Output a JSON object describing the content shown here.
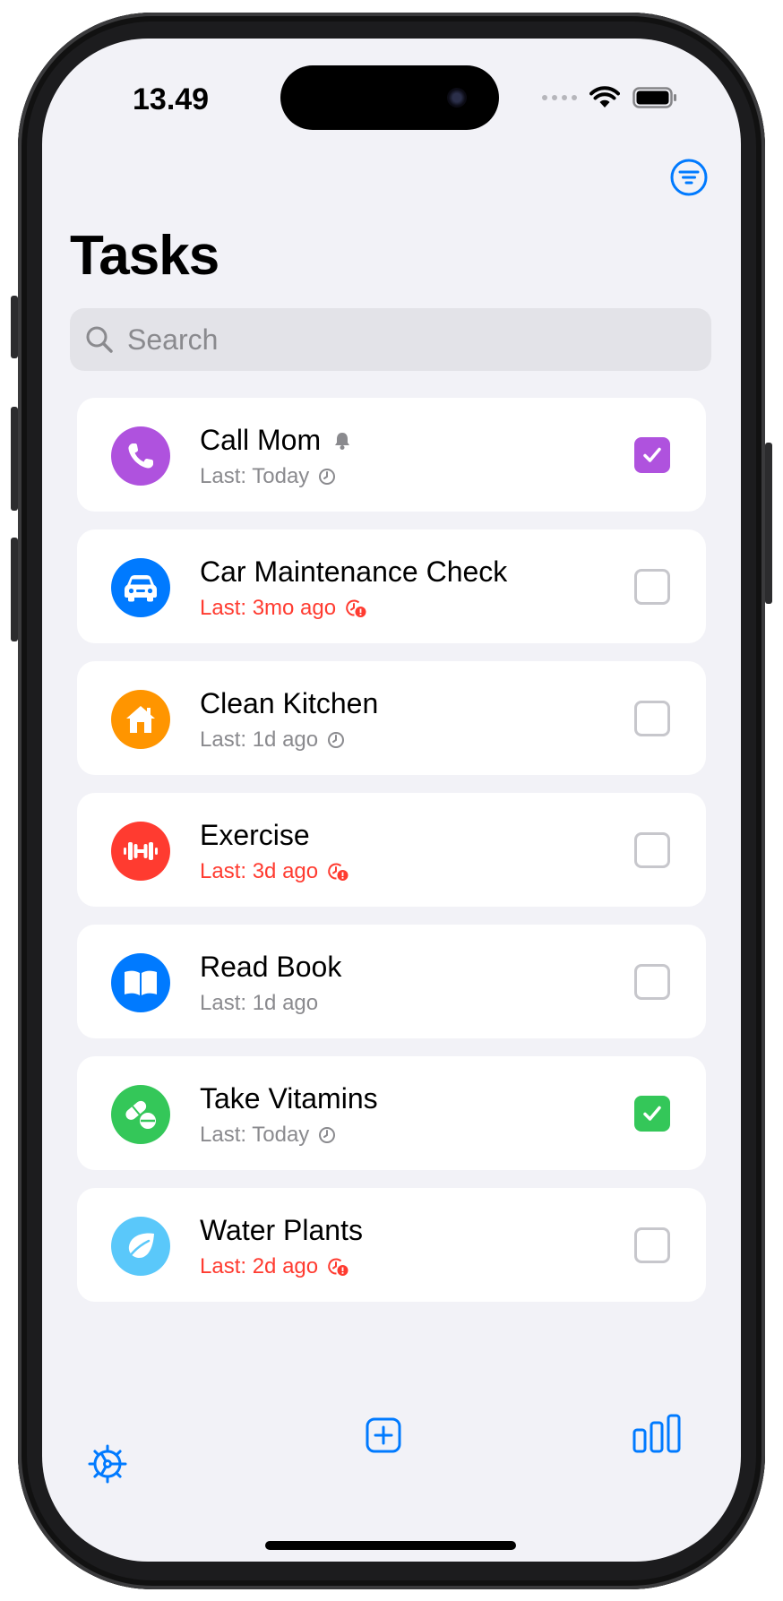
{
  "status": {
    "time": "13.49"
  },
  "title": "Tasks",
  "search": {
    "placeholder": "Search"
  },
  "tasks": [
    {
      "name": "Call Mom",
      "last": "Last: Today",
      "overdue": false,
      "done": true,
      "color": "#af52de",
      "icon": "phone-icon",
      "has_bell": true,
      "clock": "clock-icon"
    },
    {
      "name": "Car Maintenance Check",
      "last": "Last: 3mo ago",
      "overdue": true,
      "done": false,
      "color": "#007aff",
      "icon": "car-icon",
      "has_bell": false,
      "clock": "overdue-clock-icon"
    },
    {
      "name": "Clean Kitchen",
      "last": "Last: 1d ago",
      "overdue": false,
      "done": false,
      "color": "#ff9500",
      "icon": "house-icon",
      "has_bell": false,
      "clock": "clock-icon"
    },
    {
      "name": "Exercise",
      "last": "Last: 3d ago",
      "overdue": true,
      "done": false,
      "color": "#ff3b30",
      "icon": "dumbbell-icon",
      "has_bell": false,
      "clock": "overdue-clock-icon"
    },
    {
      "name": "Read Book",
      "last": "Last: 1d ago",
      "overdue": false,
      "done": false,
      "color": "#007aff",
      "icon": "book-icon",
      "has_bell": false,
      "clock": "none"
    },
    {
      "name": "Take Vitamins",
      "last": "Last: Today",
      "overdue": false,
      "done": true,
      "color": "#34c759",
      "icon": "pills-icon",
      "has_bell": false,
      "clock": "clock-icon"
    },
    {
      "name": "Water Plants",
      "last": "Last: 2d ago",
      "overdue": true,
      "done": false,
      "color": "#5ac8fa",
      "icon": "leaf-icon",
      "has_bell": false,
      "clock": "overdue-clock-icon"
    }
  ],
  "colors": {
    "accent": "#007aff",
    "overdue": "#ff3b30",
    "secondary": "#8a8a8e"
  },
  "tabbar": {
    "left_icon": "settings-gear-icon",
    "center_icon": "add-square-icon",
    "right_icon": "stats-bars-icon"
  }
}
